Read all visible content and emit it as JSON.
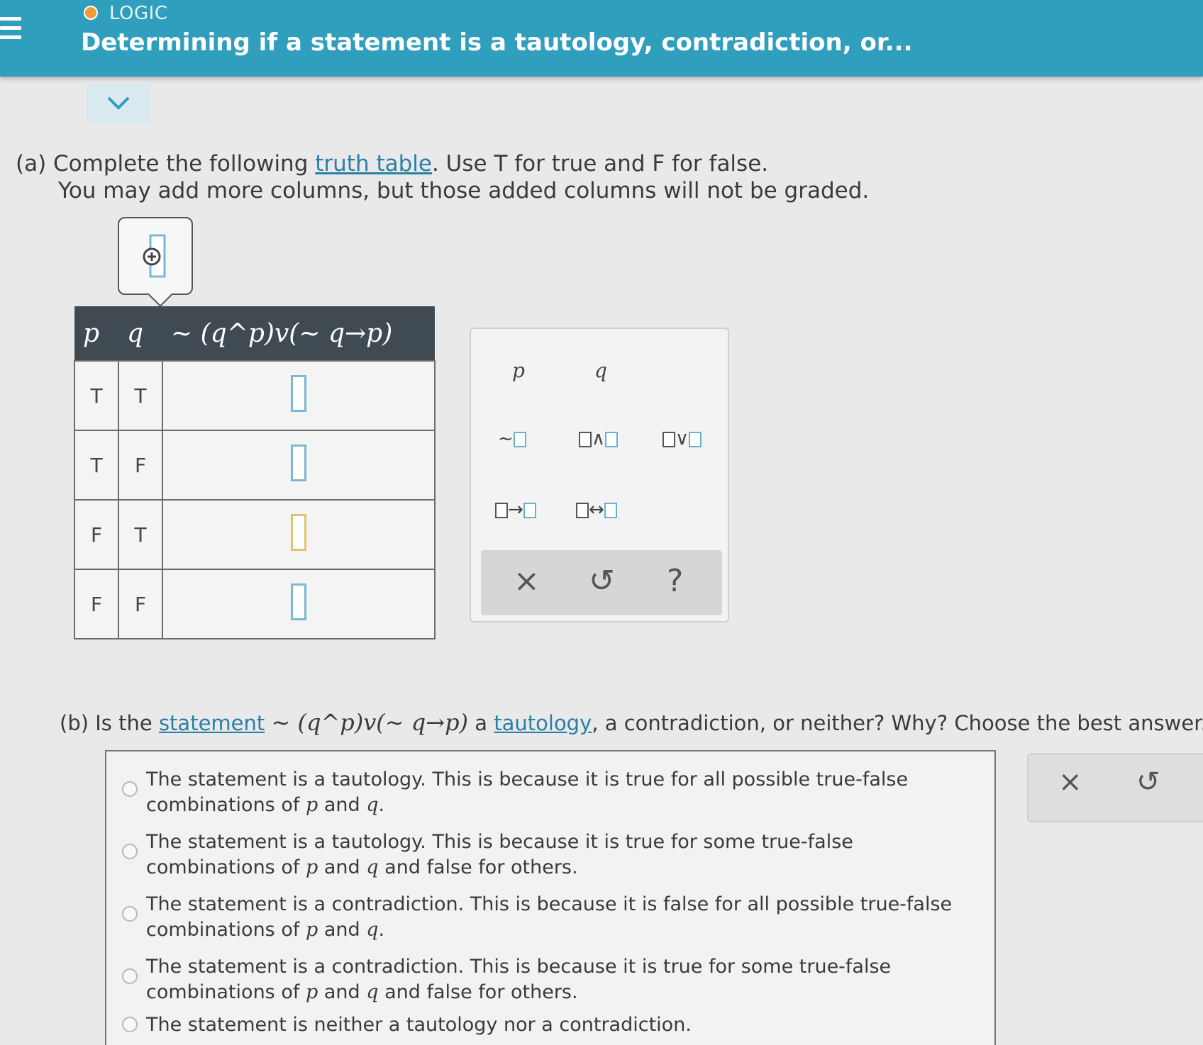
{
  "header": {
    "topic": "LOGIC",
    "title": "Determining if a statement is a tautology, contradiction, or..."
  },
  "part_a": {
    "prefix": "(a) Complete the following ",
    "link": "truth table",
    "suffix": ". Use T for true and F for false.",
    "line2": "You may add more columns, but those added columns will not be graded."
  },
  "table": {
    "headers": [
      "p",
      "q",
      "~ (q^p)v(~ q→p)"
    ],
    "rows": [
      {
        "p": "T",
        "q": "T"
      },
      {
        "p": "T",
        "q": "F"
      },
      {
        "p": "F",
        "q": "T"
      },
      {
        "p": "F",
        "q": "F"
      }
    ]
  },
  "palette": {
    "var_p": "p",
    "var_q": "q",
    "not_sym": "~",
    "and_sym": "∧",
    "or_sym": "∨",
    "implies_sym": "→",
    "iff_sym": "↔",
    "clear": "×",
    "undo": "↺",
    "help": "?"
  },
  "part_b": {
    "prefix": "(b) Is the ",
    "link1": "statement",
    "expr": "~ (q^p)v(~ q→p)",
    "mid": " a ",
    "link2": "tautology",
    "suffix": ", a contradiction, or neither? Why? Choose the best answer."
  },
  "choices": [
    {
      "l1": "The statement is a tautology. This is because it is true for all possible true-false",
      "l2a": "combinations of ",
      "v1": "p",
      "and": " and ",
      "v2": "q",
      "l2b": "."
    },
    {
      "l1": "The statement is a tautology. This is because it is true for some true-false",
      "l2a": "combinations of ",
      "v1": "p",
      "and": " and ",
      "v2": "q",
      "l2b": " and false for others."
    },
    {
      "l1": "The statement is a contradiction. This is because it is false for all possible true-false",
      "l2a": "combinations of ",
      "v1": "p",
      "and": " and ",
      "v2": "q",
      "l2b": "."
    },
    {
      "l1": "The statement is a contradiction. This is because it is true for some true-false",
      "l2a": "combinations of ",
      "v1": "p",
      "and": " and ",
      "v2": "q",
      "l2b": " and false for others."
    },
    {
      "l1": "The statement is neither a tautology nor a contradiction."
    }
  ],
  "side_panel": {
    "clear": "×",
    "undo": "↺"
  },
  "colors": {
    "header": "#2f9fbd",
    "accent": "#2a7fa6",
    "topic_dot": "#f19a3a",
    "table_header": "#3f4a52"
  }
}
